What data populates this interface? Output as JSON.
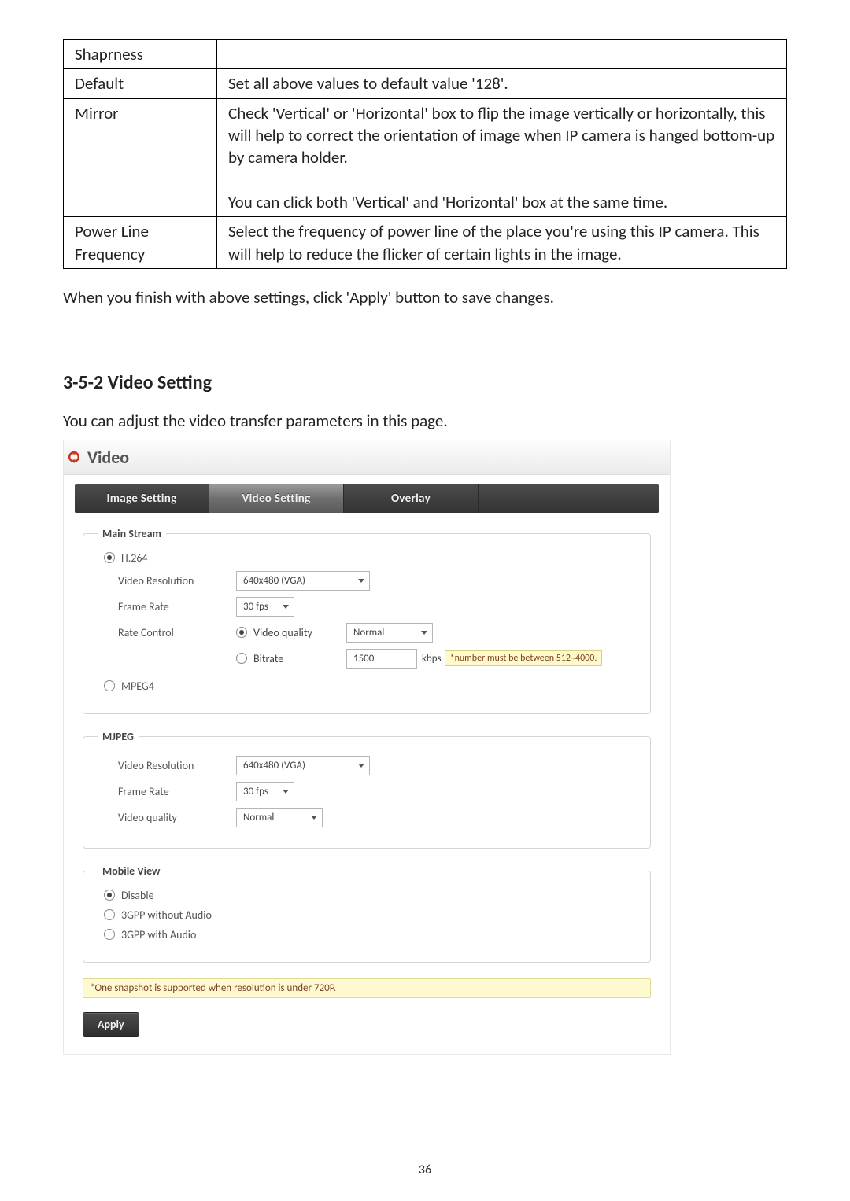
{
  "table": {
    "rows": [
      {
        "key": "Shaprness",
        "val": ""
      },
      {
        "key": "Default",
        "val": "Set all above values to default value '128'."
      },
      {
        "key": "Mirror",
        "val": "Check 'Vertical' or 'Horizontal' box to flip the image vertically or horizontally, this will help to correct the orientation of image when IP camera is hanged bottom-up by camera holder.\n\nYou can click both 'Vertical' and 'Horizontal' box at the same time."
      },
      {
        "key": "Power Line Frequency",
        "val": "Select the frequency of power line of the place you're using this IP camera. This will help to reduce the flicker of certain lights in the image."
      }
    ]
  },
  "body": {
    "after_table": "When you finish with above settings, click 'Apply' button to save changes.",
    "section_heading": "3-5-2 Video Setting",
    "intro": "You can adjust the video transfer parameters in this page."
  },
  "panel": {
    "title": "Video",
    "tabs": {
      "image": "Image Setting",
      "video": "Video Setting",
      "overlay": "Overlay"
    },
    "main_stream": {
      "legend": "Main Stream",
      "h264_label": "H.264",
      "mpeg4_label": "MPEG4",
      "video_resolution_label": "Video Resolution",
      "frame_rate_label": "Frame Rate",
      "rate_control_label": "Rate Control",
      "video_quality_label": "Video quality",
      "bitrate_label": "Bitrate",
      "resolution_value": "640x480 (VGA)",
      "frame_rate_value": "30 fps",
      "quality_value": "Normal",
      "bitrate_value": "1500",
      "bitrate_unit": "kbps",
      "bitrate_hint": "*number must be between 512~4000."
    },
    "mjpeg": {
      "legend": "MJPEG",
      "video_resolution_label": "Video Resolution",
      "frame_rate_label": "Frame Rate",
      "video_quality_label": "Video quality",
      "resolution_value": "640x480 (VGA)",
      "frame_rate_value": "30 fps",
      "quality_value": "Normal"
    },
    "mobile": {
      "legend": "Mobile View",
      "disable": "Disable",
      "without_audio": "3GPP without Audio",
      "with_audio": "3GPP with Audio"
    },
    "note": "*One snapshot is supported when resolution is under 720P.",
    "apply": "Apply"
  },
  "page_number": "36"
}
